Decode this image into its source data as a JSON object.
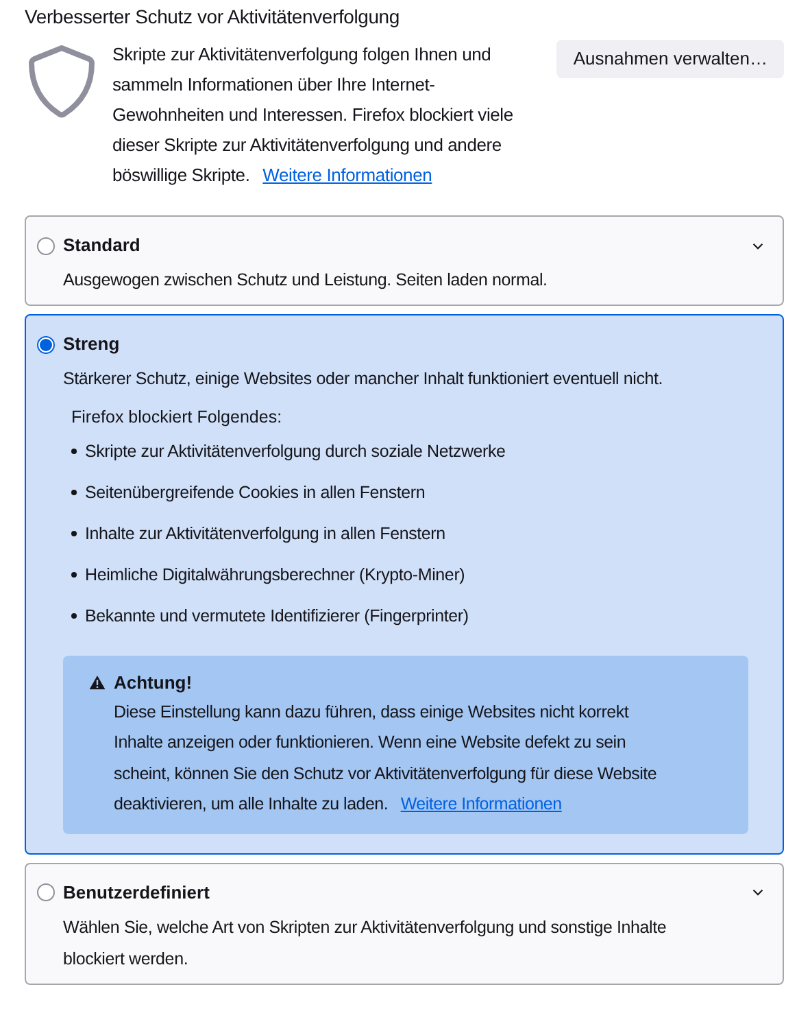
{
  "heading": "Verbesserter Schutz vor Aktivitätenverfolgung",
  "intro": {
    "text": "Skripte zur Aktivitätenverfolgung folgen Ihnen und sammeln Informationen über Ihre Internet-Gewohnheiten und Interessen. Firefox blockiert viele dieser Skripte zur Aktivitätenverfolgung und andere böswillige Skripte.",
    "link": "Weitere Informationen"
  },
  "exceptions_button": "Ausnahmen verwalten…",
  "options": [
    {
      "label": "Standard",
      "description": "Ausgewogen zwischen Schutz und Leistung. Seiten laden normal.",
      "selected": false,
      "expanded": false
    },
    {
      "label": "Streng",
      "description": "Stärkerer Schutz, einige Websites oder mancher Inhalt funktioniert eventuell nicht.",
      "selected": true,
      "expanded": true,
      "blocks_title": "Firefox blockiert Folgendes:",
      "blocks": [
        "Skripte zur Aktivitätenverfolgung durch soziale Netzwerke",
        "Seitenübergreifende Cookies in allen Fenstern",
        "Inhalte zur Aktivitätenverfolgung in allen Fenstern",
        "Heimliche Digitalwährungsberechner (Krypto-Miner)",
        "Bekannte und vermutete Identifizierer (Fingerprinter)"
      ],
      "warning": {
        "title": "Achtung!",
        "text": "Diese Einstellung kann dazu führen, dass einige Websites nicht korrekt Inhalte anzeigen oder funktionieren. Wenn eine Website defekt zu sein scheint, können Sie den Schutz vor Aktivitätenverfolgung für diese Website deaktivieren, um alle Inhalte zu laden.",
        "link": "Weitere Informationen"
      }
    },
    {
      "label": "Benutzerdefiniert",
      "description": "Wählen Sie, welche Art von Skripten zur Aktivitätenverfolgung und sonstige Inhalte blockiert werden.",
      "selected": false,
      "expanded": false
    }
  ]
}
